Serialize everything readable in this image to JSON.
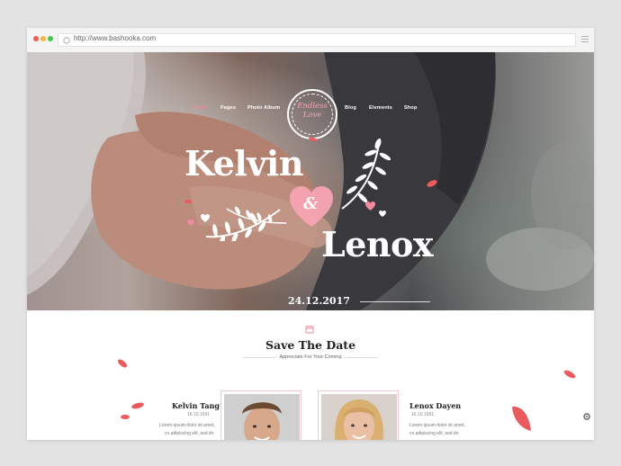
{
  "browser": {
    "url": "http://www.bashooka.com",
    "colors": {
      "close": "#f25b55",
      "minimize": "#f6b73c",
      "maximize": "#4ac44f"
    }
  },
  "nav": {
    "items": [
      {
        "label": "Home",
        "active": true
      },
      {
        "label": "Pages",
        "active": false
      },
      {
        "label": "Photo Album",
        "active": false
      },
      {
        "label": "Blog",
        "active": false
      },
      {
        "label": "Elements",
        "active": false
      },
      {
        "label": "Shop",
        "active": false
      }
    ]
  },
  "logo": {
    "line1": "Endless",
    "line2": "Love"
  },
  "hero": {
    "name_left": "Kelvin",
    "ampersand": "&",
    "name_right": "Lenox",
    "date": "24.12.2017"
  },
  "save_the_date": {
    "title": "Save The Date",
    "subtitle": "Appreciate For Your Coming"
  },
  "couple": {
    "groom": {
      "name": "Kelvin Tang",
      "birth": "16.10.1991",
      "line1": "Lorem ipsum dolor sit amet,",
      "line2": "co adipiscing elit, sed do"
    },
    "bride": {
      "name": "Lenox Dayen",
      "birth": "16.10.1991",
      "line1": "Lorem ipsum dolor sit amet,",
      "line2": "co adipiscing elit, sed do"
    }
  },
  "colors": {
    "accent": "#f28a9c",
    "petal": "#e95b5f"
  }
}
